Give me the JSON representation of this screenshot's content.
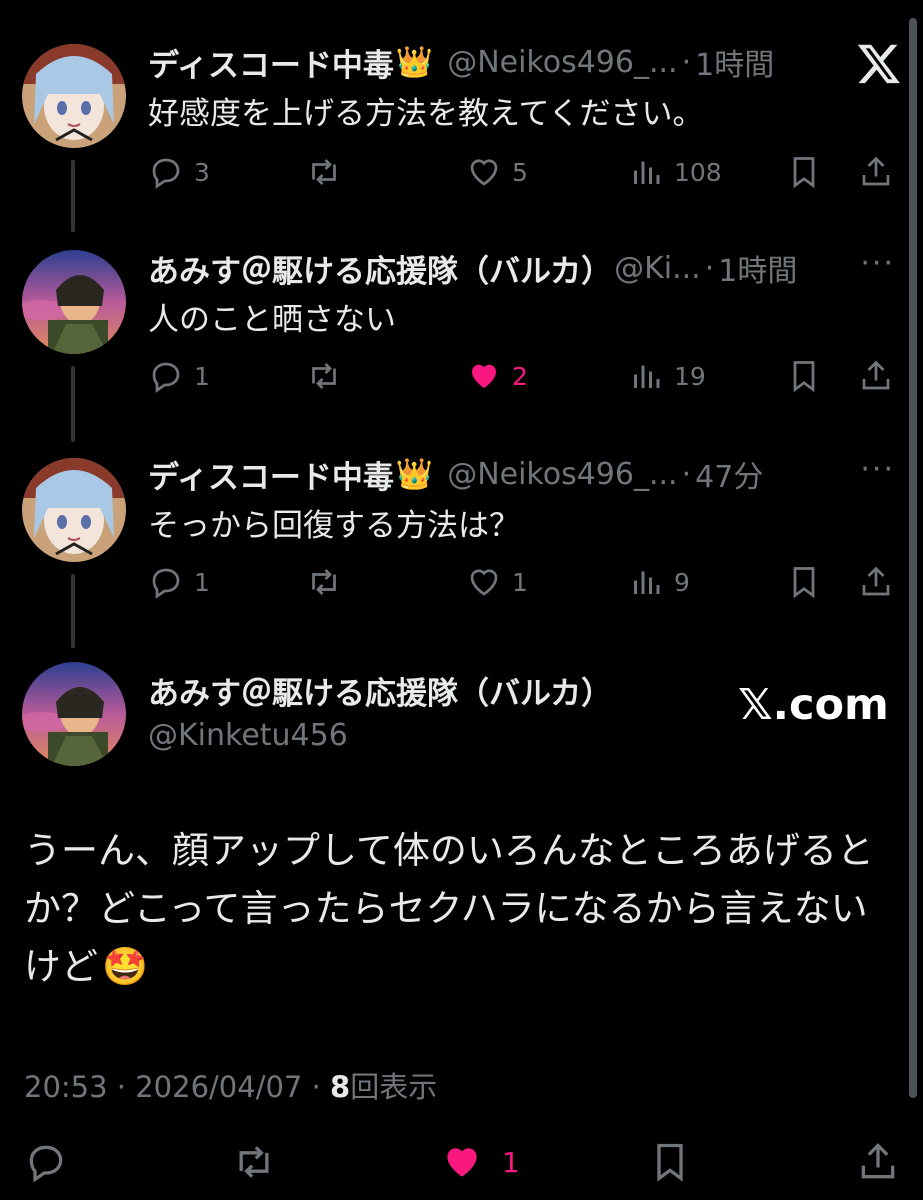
{
  "posts": [
    {
      "user": "ディスコード中毒",
      "handle": "@Neikos496_...",
      "sep": "·",
      "time": "1時間",
      "text": "好感度を上げる方法を教えてください。",
      "replies": "3",
      "reposts": "",
      "likes": "5",
      "views": "108",
      "liked": false
    },
    {
      "user": "あみす＠駆ける応援隊（バルカ）",
      "handle": "@Ki...",
      "sep": "·",
      "time": "1時間",
      "text": "人のこと晒さない",
      "replies": "1",
      "reposts": "",
      "likes": "2",
      "views": "19",
      "liked": true
    },
    {
      "user": "ディスコード中毒",
      "handle": "@Neikos496_...",
      "sep": "·",
      "time": "47分",
      "text": "そっから回復する方法は？",
      "replies": "1",
      "reposts": "",
      "likes": "1",
      "views": "9",
      "liked": false
    }
  ],
  "main": {
    "user": "あみす＠駆ける応援隊（バルカ）",
    "handle": "@Kinketu456",
    "brand": "𝕏.com",
    "text_line1": "うーん、顔アップして体のいろんなところあげると",
    "text_line2": "か？どこって言ったらセクハラになるから言えない",
    "text_line3": "けど",
    "time": "20:53",
    "sep": "·",
    "date": "2026/04/07",
    "views_count": "8",
    "views_label": "回表示",
    "likes": "1"
  },
  "more_label": "···",
  "icons": {
    "x_logo": "x-logo-icon",
    "reply": "reply-icon",
    "repost": "repost-icon",
    "like": "heart-icon",
    "views": "views-icon",
    "bookmark": "bookmark-icon",
    "share": "share-icon",
    "crown": "crown-icon",
    "emoji": "star-struck-emoji-icon"
  },
  "colors": {
    "background": "#000000",
    "text": "#e7e9ea",
    "muted": "#71767b",
    "like": "#f91880"
  }
}
